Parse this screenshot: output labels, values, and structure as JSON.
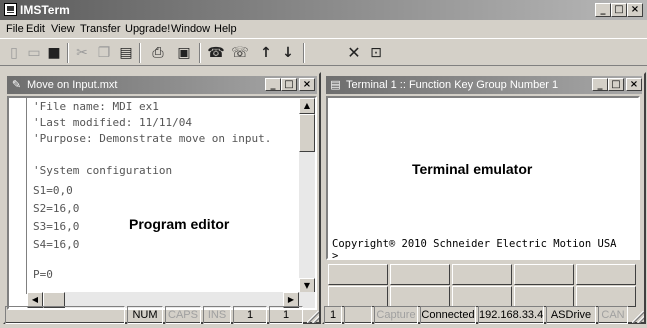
{
  "app": {
    "title": "IMSTerm"
  },
  "menubar": [
    "File",
    "Edit",
    "View",
    "Transfer",
    "Upgrade!",
    "Window",
    "Help"
  ],
  "toolbar": {
    "icons": [
      "new-file-icon",
      "open-file-icon",
      "save-icon",
      "cut-icon",
      "copy-icon",
      "paste-icon",
      "print-icon",
      "properties-icon",
      "connect-phone-icon",
      "disconnect-phone-icon",
      "upload-arrow-icon",
      "download-arrow-icon",
      "delete-x-icon",
      "stop-square-icon"
    ]
  },
  "editor": {
    "title": "Move on Input.mxt",
    "lines": [
      "'File name: MDI ex1",
      "'Last modified: 11/11/04",
      "'Purpose: Demonstrate move on input.",
      "",
      "'System configuration",
      "S1=0,0",
      "S2=16,0",
      "S3=16,0",
      "S4=16,0",
      "",
      "P=0"
    ],
    "status": [
      "NUM",
      "CAPS",
      "INS",
      "1",
      "1"
    ]
  },
  "terminal": {
    "title": "Terminal 1 :: Function Key Group Number 1",
    "lines": [
      "Copyright® 2010 Schneider Electric Motion USA",
      ">"
    ],
    "status": [
      "1",
      "",
      "Capture",
      "Connected",
      "192.168.33.4",
      "ASDrive",
      "CAN"
    ]
  },
  "callouts": {
    "editor": "Program editor",
    "terminal": "Terminal emulator"
  },
  "colors": {
    "title_bar": "#5c5c5c",
    "face": "#d4d0c8",
    "code_text": "#555555"
  }
}
